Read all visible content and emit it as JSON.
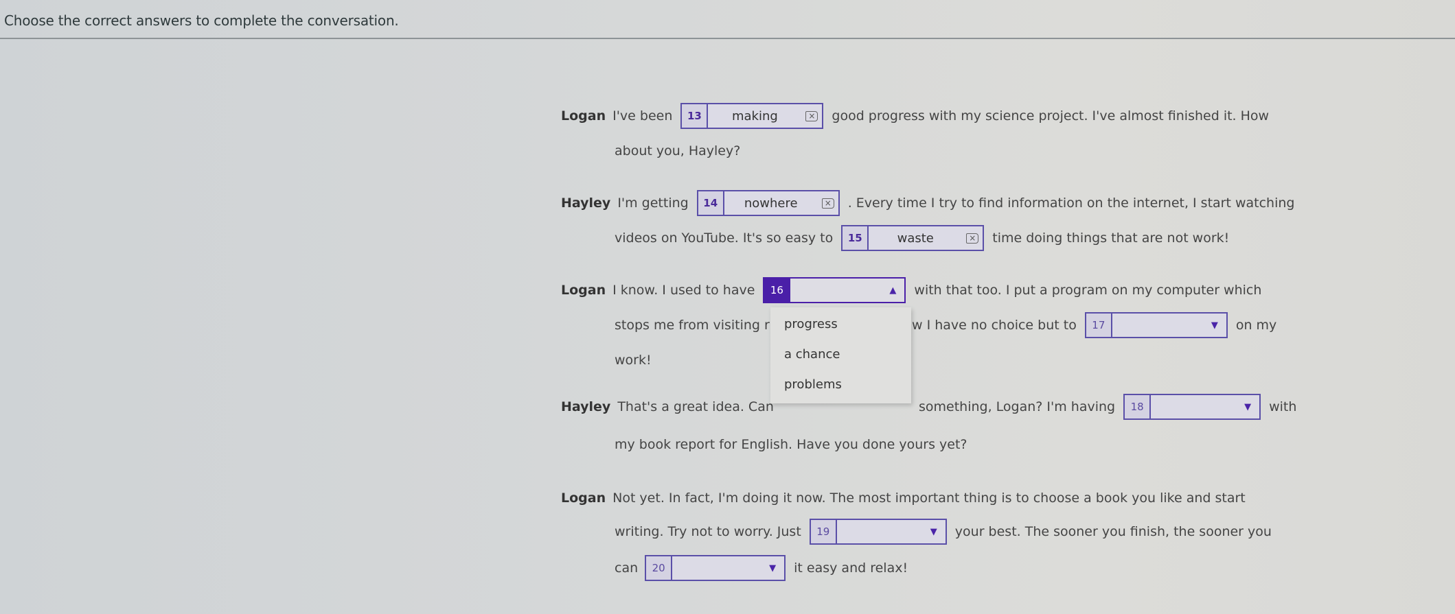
{
  "instruction": "Choose the correct answers to complete the conversation.",
  "colors": {
    "accent": "#4a1fa8",
    "box_border": "#5a4fa8"
  },
  "conversation": {
    "l1": {
      "speaker": "Logan",
      "before": "I've been",
      "blank": {
        "number": "13",
        "value": "making",
        "clear_icon": "backspace-icon"
      },
      "after": "good progress with my science project. I've almost finished it. How"
    },
    "l1b": "about you, Hayley?",
    "l2": {
      "speaker": "Hayley",
      "before": "I'm getting",
      "blank": {
        "number": "14",
        "value": "nowhere"
      },
      "after": ". Every time I try to find information on the internet, I start watching"
    },
    "l2b": {
      "before": "videos on YouTube. It's so easy to",
      "blank": {
        "number": "15",
        "value": "waste"
      },
      "after": "time doing things that are not work!"
    },
    "l3": {
      "speaker": "Logan",
      "before": "I know. I used to have",
      "blank": {
        "number": "16",
        "value": ""
      },
      "after": "with that too. I put a program on my computer which"
    },
    "l3b": {
      "before": "stops me from visiting r",
      "after_visible": "w I have no choice but to",
      "blank": {
        "number": "17",
        "value": ""
      },
      "after": "on my"
    },
    "l3c": "work!",
    "l4": {
      "speaker": "Hayley",
      "before": "That's a great idea. Can",
      "after_visible": "something, Logan? I'm having",
      "blank": {
        "number": "18",
        "value": ""
      },
      "after": "with"
    },
    "l4b": "my book report for English. Have you done yours yet?",
    "l5": {
      "speaker": "Logan",
      "text": "Not yet. In fact, I'm doing it now. The most important thing is to choose a book you like and start"
    },
    "l5b": {
      "before": "writing. Try not to worry. Just",
      "blank": {
        "number": "19",
        "value": ""
      },
      "after": "your best. The sooner you finish, the sooner you"
    },
    "l5c": {
      "before": "can",
      "blank": {
        "number": "20",
        "value": ""
      },
      "after": "it easy and relax!"
    }
  },
  "dropdown16": {
    "open": true,
    "options": [
      "progress",
      "a chance",
      "problems"
    ]
  }
}
